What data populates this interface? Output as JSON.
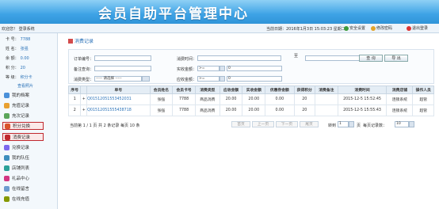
{
  "header": {
    "title": "会员自助平台管理中心"
  },
  "topbar": {
    "welcome": "欢迎您！ 登录系统",
    "date": "当前日期：2016年1月3日 15:03:23 星期二",
    "links": [
      "安全设置",
      "修改密码",
      "退出登录"
    ]
  },
  "member": {
    "card_label": "卡 号：",
    "card": "7788",
    "name_label": "姓 名：",
    "name": "张强",
    "balance_label": "余 额：",
    "balance": "0.00",
    "points_label": "积 分：",
    "points": "20",
    "level_label": "等 级：",
    "level": "积分卡",
    "photo": "查看照片"
  },
  "menu": [
    "我的档案",
    "充值记录",
    "充次记录",
    "积分兑换",
    "消费记录",
    "兑换记录",
    "我的队伍",
    "店铺列表",
    "礼品中心",
    "在线留言",
    "在线充值"
  ],
  "panel": {
    "title": "消费记录"
  },
  "form": {
    "order_label": "订单编号：",
    "note_label": "备注查询：",
    "type_label": "消费类型：",
    "type_value": "----- 请选择 -----",
    "time_label": "消费时间：",
    "time_to": "至",
    "pay_label": "实收金额：",
    "pay_op": ">=",
    "pay_value": "0",
    "due_label": "应收金额：",
    "due_op": ">=",
    "due_value": "0",
    "query_button": "查 询",
    "export_button": "导 出"
  },
  "table": {
    "headers": [
      "序号",
      "",
      "单号",
      "会员姓名",
      "会员卡号",
      "消费类型",
      "应收金额",
      "实收金额",
      "优惠券金额",
      "获得积分",
      "消费备注",
      "消费时间",
      "消费店铺",
      "操作人员"
    ],
    "rows": [
      [
        "1",
        "+",
        "Q01512051553452031",
        "张强",
        "7788",
        "商品消费",
        "20.00",
        "20.00",
        "0.00",
        "20",
        "",
        "2015-12-5 15:52:45",
        "连锁系统",
        "超管"
      ],
      [
        "2",
        "+",
        "Q01512051555438718",
        "张强",
        "7788",
        "商品消费",
        "20.00",
        "20.00",
        "0.00",
        "20",
        "",
        "2015-12-5 15:55:43",
        "连锁系统",
        "超管"
      ]
    ]
  },
  "pager": {
    "summary": "当前第 1 / 1 页 共 2 条记录 每页 10 条",
    "first": "首页",
    "prev": "上一页",
    "next": "下一页",
    "last": "尾页",
    "goto_label": "转到",
    "page_value": "1",
    "page_unit": "页",
    "size_label": "每页记录数：",
    "size_value": "10"
  }
}
